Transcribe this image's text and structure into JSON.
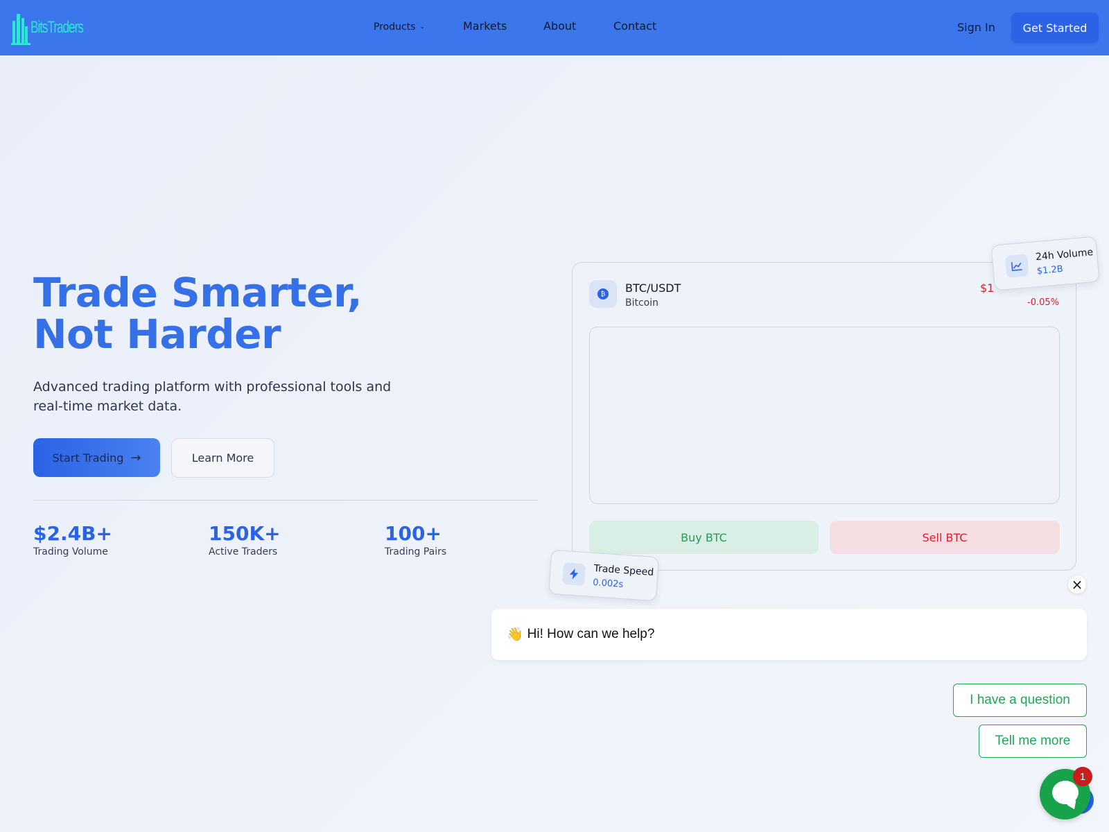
{
  "nav": {
    "logo_text": "BitsTraders",
    "products": "Products",
    "markets": "Markets",
    "about": "About",
    "contact": "Contact",
    "sign_in": "Sign In",
    "get_started": "Get Started"
  },
  "hero": {
    "title_line1": "Trade Smarter,",
    "title_line2": "Not Harder",
    "subtitle": "Advanced trading platform with professional tools and real-time market data.",
    "start_trading": "Start Trading",
    "learn_more": "Learn More"
  },
  "stats": [
    {
      "value": "$2.4B+",
      "label": "Trading Volume"
    },
    {
      "value": "150K+",
      "label": "Active Traders"
    },
    {
      "value": "100+",
      "label": "Trading Pairs"
    }
  ],
  "trade_card": {
    "pair": "BTC/USDT",
    "name": "Bitcoin",
    "price_partial": "$1",
    "change": "-0.05%",
    "buy_label": "Buy BTC",
    "sell_label": "Sell BTC"
  },
  "badges": {
    "volume_title": "24h Volume",
    "volume_value": "$1.2B",
    "speed_title": "Trade Speed",
    "speed_value": "0.002s"
  },
  "chat": {
    "greeting": "Hi! How can we help?",
    "option_1": "I have a question",
    "option_2": "Tell me more",
    "unread_count": "1"
  },
  "colors": {
    "nav_bg": "#3b76ed",
    "primary": "#2a63e6",
    "accent_cyan": "#2ee6d6",
    "buy_green": "#1f9d55",
    "sell_red": "#e11d2a",
    "chat_green": "#16a34a"
  }
}
